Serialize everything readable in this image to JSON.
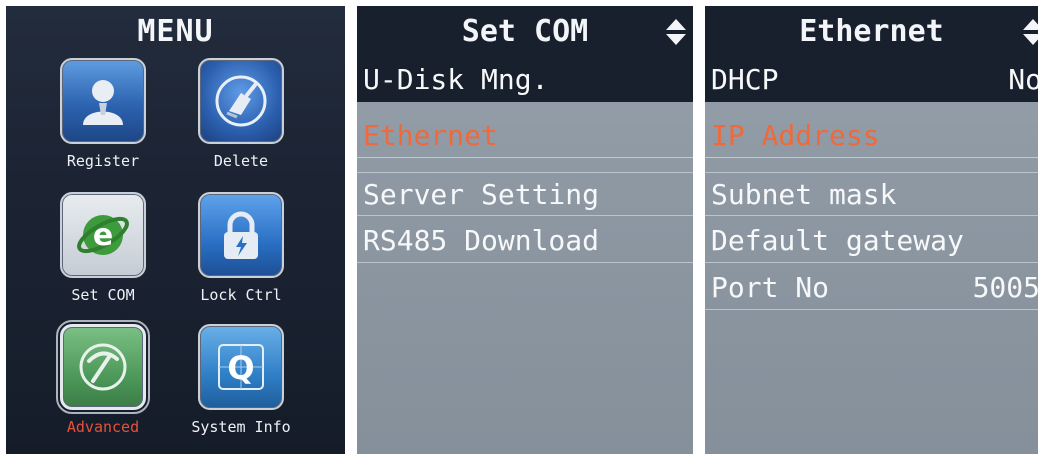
{
  "menu": {
    "title": "MENU",
    "items": [
      {
        "label": "Register",
        "icon": "register-user-icon"
      },
      {
        "label": "Delete",
        "icon": "delete-broom-icon"
      },
      {
        "label": "Set COM",
        "icon": "ie-globe-icon"
      },
      {
        "label": "Lock Ctrl",
        "icon": "padlock-icon"
      },
      {
        "label": "Advanced",
        "icon": "pickaxe-icon",
        "selected": true
      },
      {
        "label": "System Info",
        "icon": "info-q-icon"
      }
    ]
  },
  "set_com": {
    "title": "Set COM",
    "items": [
      {
        "label": "U-Disk Mng."
      },
      {
        "label": "Ethernet",
        "selected": true
      },
      {
        "label": "Server Setting"
      },
      {
        "label": "RS485 Download"
      }
    ]
  },
  "ethernet": {
    "title": "Ethernet",
    "items": [
      {
        "label": "DHCP",
        "value": "No"
      },
      {
        "label": "IP Address",
        "selected": true
      },
      {
        "label": "Subnet mask"
      },
      {
        "label": "Default gateway"
      },
      {
        "label": "Port No",
        "value": "5005"
      }
    ]
  },
  "colors": {
    "highlight_text": "#ef6a3a",
    "header_bg": "#17202c",
    "list_bg": "#8e98a3",
    "menu_bg": "#1c2434"
  }
}
